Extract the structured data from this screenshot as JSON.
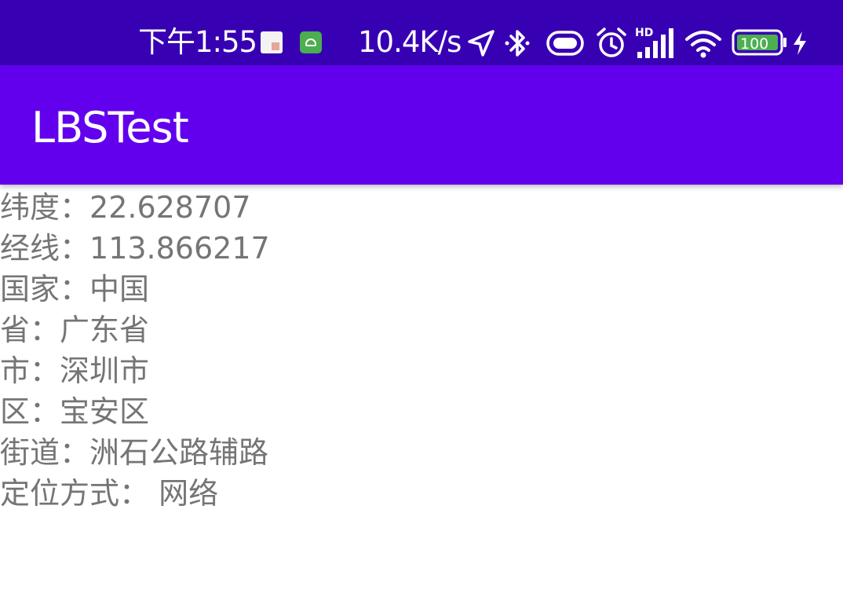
{
  "status_bar": {
    "time": "下午1:55",
    "net_speed": "10.4K/s",
    "battery": "100",
    "icons": [
      "notification-app-icon",
      "notification-android-icon",
      "location-icon",
      "bluetooth-icon",
      "vibrate-icon",
      "alarm-icon",
      "hd-signal-icon",
      "wifi-icon",
      "battery-icon",
      "charging-icon"
    ]
  },
  "app_bar": {
    "title": "LBSTest"
  },
  "location_info": [
    {
      "label": "纬度：",
      "value": "22.628707"
    },
    {
      "label": "经线：",
      "value": "113.866217"
    },
    {
      "label": "国家：",
      "value": "中国"
    },
    {
      "label": "省：",
      "value": "广东省"
    },
    {
      "label": "市：",
      "value": "深圳市"
    },
    {
      "label": "区：",
      "value": "宝安区"
    },
    {
      "label": "街道：",
      "value": "洲石公路辅路"
    },
    {
      "label": "定位方式：",
      "value": " 网络"
    }
  ],
  "colors": {
    "status_bar": "#3700B3",
    "app_bar": "#6200EE",
    "text": "#757575"
  }
}
